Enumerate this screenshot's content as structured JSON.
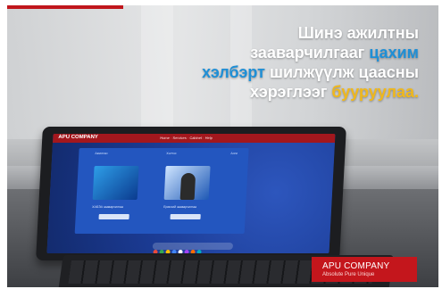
{
  "headline": {
    "line1": "Шинэ ажилтны",
    "line2_a": "зааварчилгааг ",
    "line2_b": "цахим",
    "line3_a": "хэлбэрт",
    "line3_b": " шилжүүлж цаасны",
    "line4_a": "хэрэглээг ",
    "line4_b": "бууруулаа."
  },
  "badge": {
    "title": "APU COMPANY",
    "subtitle": "Absolute Pure Unique"
  },
  "tablet_screen": {
    "logo": "APU COMPANY",
    "nav": "Home · Services · Cabinet · Help",
    "meta_left": "Ажилтан",
    "meta_mid": "Хэлтэс",
    "meta_right": "Анги",
    "card1_caption": "ХАБЭА зааварчилгаа",
    "card2_caption": "Ерөнхий зааварчилгаа"
  },
  "colors": {
    "brand_red": "#c4161c",
    "accent_blue": "#1f8fd6",
    "accent_yellow": "#f0b81c"
  }
}
